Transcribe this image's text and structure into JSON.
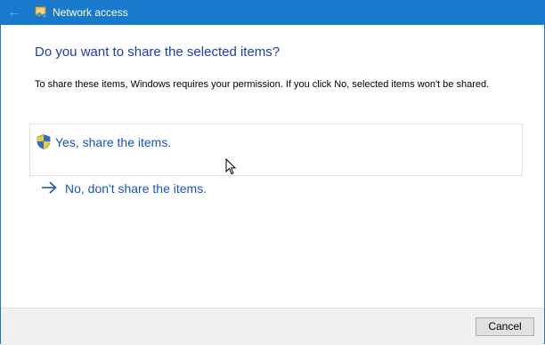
{
  "window": {
    "title": "Network access",
    "back_icon": "back-arrow-icon",
    "title_icon": "network-share-icon",
    "accent_color": "#1979ca"
  },
  "main": {
    "heading": "Do you want to share the selected items?",
    "description": "To share these items, Windows requires your permission. If you click No, selected items won't be shared.",
    "options": [
      {
        "label": "Yes, share the items.",
        "icon": "uac-shield-icon"
      },
      {
        "label": "No, don't share the items.",
        "icon": "arrow-right-icon"
      }
    ],
    "link_color": "#1a55b8"
  },
  "footer": {
    "cancel_label": "Cancel"
  }
}
